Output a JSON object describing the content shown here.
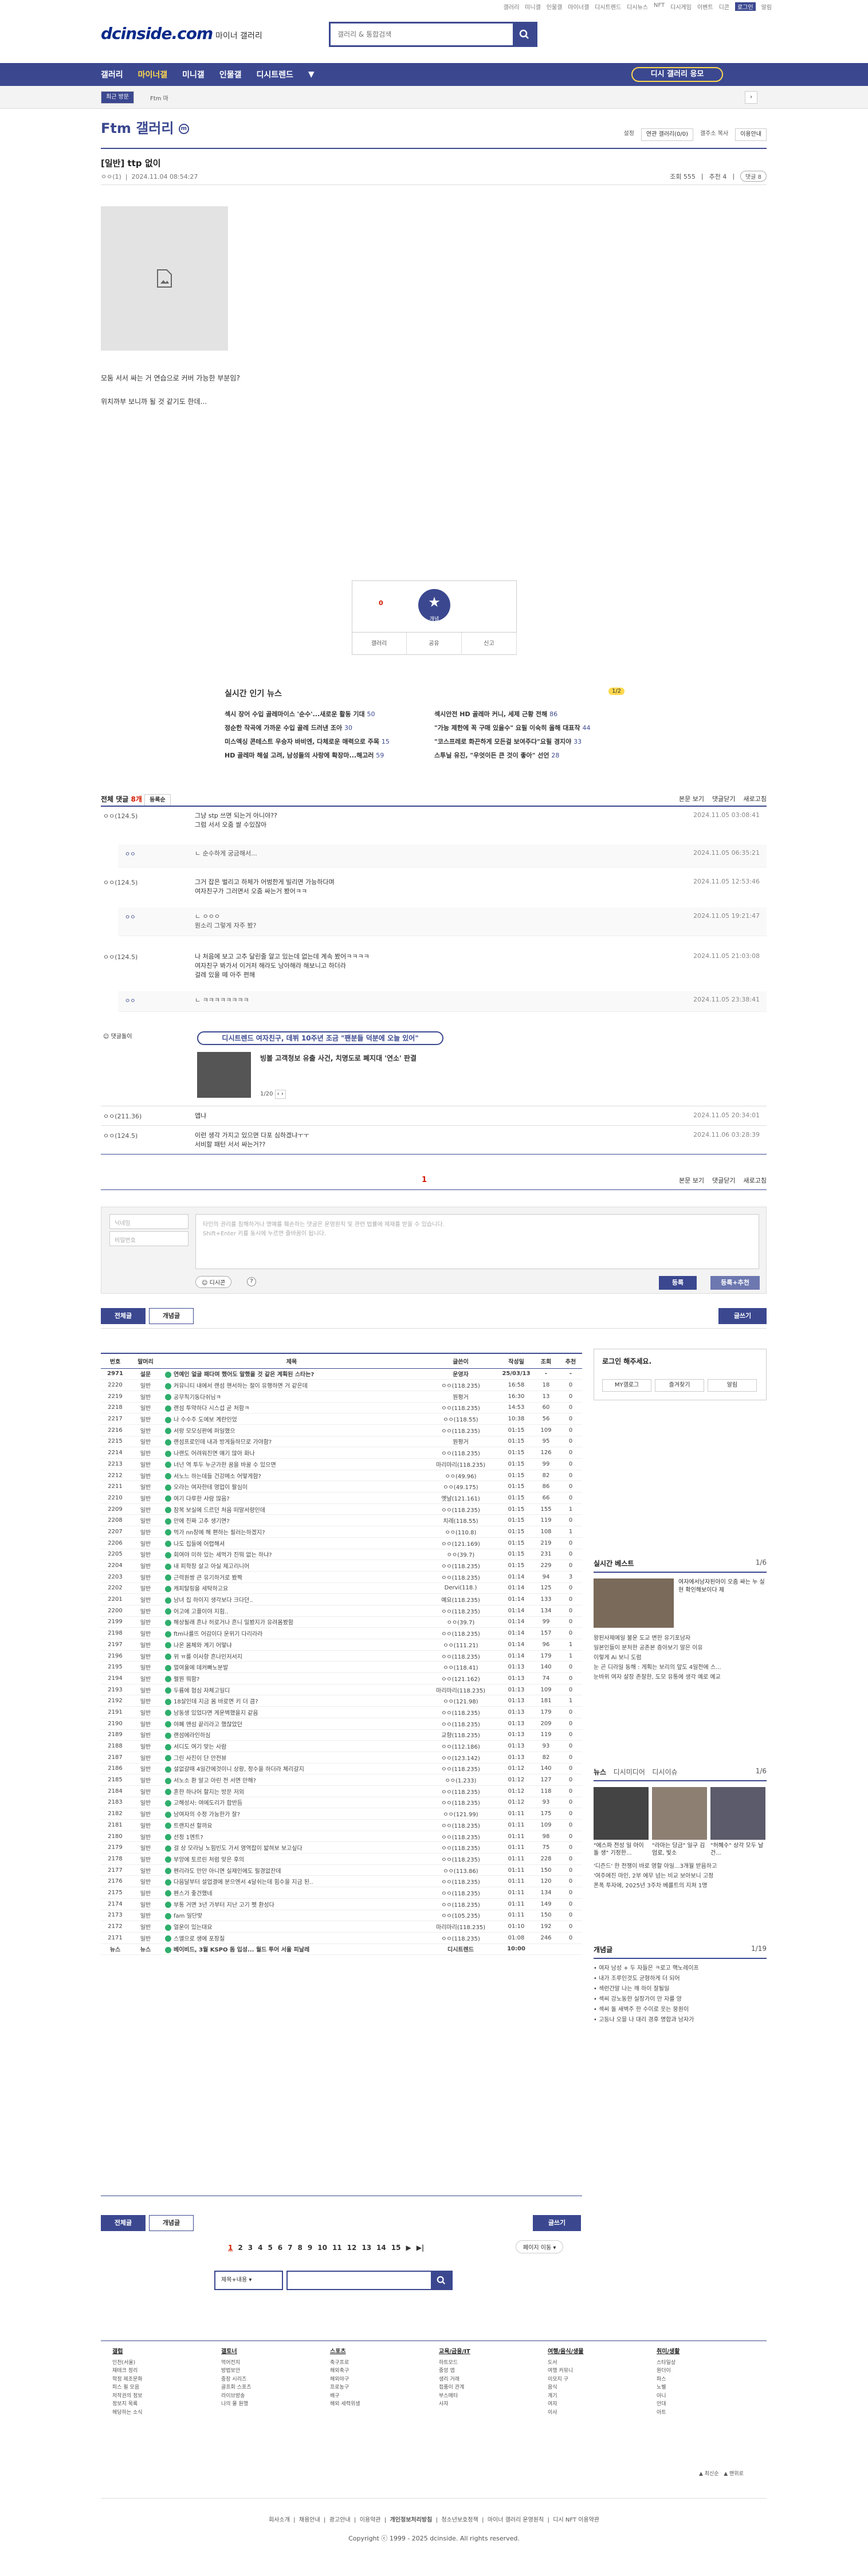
{
  "util_links": [
    "갤러리",
    "미니갤",
    "인물갤",
    "마이너갤",
    "디시트렌드",
    "디시뉴스",
    "NFT",
    "디시게임",
    "이벤트",
    "디콘",
    "로그인",
    "알림"
  ],
  "logo": "dcinside.com",
  "logo_sub": "마이너 갤러리",
  "search": {
    "placeholder": "갤러리 & 통합검색"
  },
  "gnb": {
    "items": [
      "갤러리",
      "마이너갤",
      "미니갤",
      "인물갤",
      "디시트렌드",
      "▼"
    ],
    "apply": "디시 갤러리 응모"
  },
  "subbar": {
    "recent": "최근 방문",
    "ftm": "Ftm 마"
  },
  "gallery_title": "Ftm 갤러리",
  "gallery_tools": [
    "설정",
    "연관 갤러리(0/0)",
    "갤주소 복사",
    "이용안내"
  ],
  "post": {
    "title": "[일반] ttp 없이",
    "author": "ㅇㅇ(1)",
    "date": "2024.11.04 08:54:27",
    "views": "조회 555",
    "rec": "추천 4",
    "comments": "댓글 8",
    "body": [
      "모둠 서서 싸는 거 연습으로 커버 가능한 부분임?",
      "위치까부 보니까 될 것 같기도 한데..."
    ]
  },
  "recommend": {
    "up": "0",
    "label": "개념",
    "share_labels": [
      "갤러리",
      "공유",
      "신고"
    ]
  },
  "news": {
    "title": "실시간 인기 뉴스",
    "page": "1/2",
    "items": [
      {
        "t": "섹시 장어 수입 골레마이스 '순수'...새로운 활동 기대",
        "c": "50"
      },
      {
        "t": "섹시안전 HD 골레마 커니, 세제 근황 전해",
        "c": "86"
      },
      {
        "t": "정순한 작곡에 가까운 수입 골레 드러낸 조아",
        "c": "30"
      },
      {
        "t": "\"가능 제한에 꼭 구매 있을수\" 요필 이숙히 올해 대표작",
        "c": "44"
      },
      {
        "t": "미스엑싱 콘테스트 우승자 바비엔, 다체로운 매력으로 주목",
        "c": "15"
      },
      {
        "t": "\"코스프레로 화끈하게 모든걸 보여주다\"요필 경지야",
        "c": "33"
      },
      {
        "t": "HD 골레마 해설 고려, 남성들의 사랑에 확장마...해고러",
        "c": "59"
      },
      {
        "t": "스투닐 유진, \"우엇이든 큰 것이 좋아\" 선언",
        "c": "28"
      }
    ]
  },
  "comments": {
    "label": "전체 댓글",
    "count": "8개",
    "sort": "등록순",
    "right": [
      "본문 보기",
      "댓글닫기",
      "새로고침"
    ],
    "list": [
      {
        "nick": "ㅇㅇ(124.5)",
        "text": "그냥 stp 쓰면 되는거 아니야??\n그럼 서서 오줌 쌀 수있잖아",
        "date": "2024.11.05 03:08:41"
      },
      {
        "nick": "ㅇㅇ(124.5)",
        "text": "그거 잡은 벌리고 하체가 어벙한게 빌리면 가능하다며\n여자친구가 그러면서 오줌 싸는거 봤어ㅋㅋ",
        "date": "2024.11.05 12:53:46"
      },
      {
        "nick": "ㅇㅇ(124.5)",
        "text": "나 처음에 보고 고추 달린줄 알고 있는데 없는데 계속 봤어ㅋㅋㅋㅋ\n여자친구 봐가서 이거저 해라도 낭아해라 해보니고 하더라\n걸레 있을 떼 아주 편해",
        "date": "2024.11.05 21:03:08"
      }
    ],
    "replies": [
      {
        "nick": "ㅇㅇ",
        "text": "ㄴ 순수하게 궁금해서...",
        "date": "2024.11.05 06:35:21"
      },
      {
        "nick": "ㅇㅇ",
        "text": "ㄴ ㅇㅇㅇ\n뭔소리 그렇게 자주 봤?",
        "date": "2024.11.05 19:21:47"
      },
      {
        "nick": "ㅇㅇ",
        "text": "ㄴ ㅋㅋㅋㅋㅋㅋㅋㅋ",
        "date": "2024.11.05 23:38:41"
      }
    ],
    "ad_label": "댓글돌이",
    "ad_box": "디시트렌드 여자친구, 데뷔 10주년 조금 \"팬분들 덕분에 오늘 있어\"",
    "ad_title": "빙볼 고객청보 유출 사건, 치명도로 폐지대 '연소' 판결",
    "ad_page": "1/20",
    "late": [
      {
        "nick": "ㅇㅇ(211.36)",
        "text": "앱냐",
        "date": "2024.11.05 20:34:01"
      },
      {
        "nick": "ㅇㅇ(124.5)",
        "text": "이런 생각 가지고 있으면 다포 심하겠냐ㅜㅜ\n서비할 패턴 서서 싸는거??",
        "date": "2024.11.06 03:28:39"
      }
    ],
    "page": "1"
  },
  "form": {
    "nick": "닉네임",
    "pw": "비밀번호",
    "placeholder": "타인의 권리를 침해하거나 명예를 훼손하는 댓글은 운영원칙 및 관련 법률에 제재를 받을 수 있습니다.\nShift+Enter 키를 동시에 누르면 줄바꿈이 됩니다.",
    "dccon": "디시콘",
    "submit": "등록",
    "submit_rec": "등록+추천"
  },
  "list_tabs": {
    "all": "전체글",
    "concept": "개념글",
    "write": "글쓰기"
  },
  "table": {
    "headers": [
      "번호",
      "말머리",
      "제목",
      "글쓴이",
      "작성일",
      "조회",
      "추천"
    ],
    "rows": [
      [
        "2971",
        "설문",
        "연예인 얼굴 패다며 했어도 말했을 것 같은 계획된 스타는?",
        "운영자",
        "25/03/13",
        "-",
        "-"
      ],
      [
        "2220",
        "일반",
        "커뮤니티 내에서 랜섬 핸서하는 절이 유행하면 거 같은데",
        "ㅇㅇ(118.235)",
        "16:58",
        "18",
        "0"
      ],
      [
        "2219",
        "일반",
        "공무직기동다쉬님ㅋ",
        "뭔평거",
        "16:30",
        "13",
        "0"
      ],
      [
        "2218",
        "일반",
        "랜섬 투약하다 시스섭 곧 처함ㅋ",
        "ㅇㅇ(118.235)",
        "14:53",
        "60",
        "0"
      ],
      [
        "2217",
        "일반",
        "나 수수주 도에보 계란인었",
        "ㅇㅇ(118.55)",
        "10:38",
        "56",
        "0"
      ],
      [
        "2216",
        "일반",
        "서랑 모모싱판에 퍼일했으",
        "ㅇㅇ(118.235)",
        "01:15",
        "109",
        "0"
      ],
      [
        "2215",
        "일반",
        "랜섬프로인데 내과 방게들하므로 가야함?",
        "뭔평거",
        "01:15",
        "95",
        "0"
      ],
      [
        "2214",
        "일반",
        "나랜도 어려워진면 얘기 많아 화나",
        "ㅇㅇ(118.235)",
        "01:15",
        "126",
        "0"
      ],
      [
        "2213",
        "일반",
        "너넌 역 투두 누군가한 꿈을 바꿀 수 있으면",
        "마리마리(118.235)",
        "01:15",
        "99",
        "0"
      ],
      [
        "2212",
        "일반",
        "서노느 하는데들 건강메소 어떻게함?",
        "ㅇㅇ(49.96)",
        "01:15",
        "82",
        "0"
      ],
      [
        "2211",
        "일반",
        "오라는 여자한테 영업이 팔심이",
        "ㅇㅇ(49.175)",
        "01:15",
        "86",
        "0"
      ],
      [
        "2210",
        "일반",
        "여기 다루한 사람 많음?",
        "옛날(121.161)",
        "01:15",
        "66",
        "0"
      ],
      [
        "2209",
        "일반",
        "잠복 보실에 드르던 처음 떠말서령인데",
        "ㅇㅇ(118.235)",
        "01:15",
        "155",
        "1"
      ],
      [
        "2208",
        "일반",
        "만에 진짜 고추 생기면?",
        "치레(118.55)",
        "01:15",
        "119",
        "0"
      ],
      [
        "2207",
        "일반",
        "먹가 nn창에 해 편하는 필러는하겠지?",
        "ㅇㅇ(110.8)",
        "01:15",
        "108",
        "1"
      ],
      [
        "2206",
        "일반",
        "나도 집들에 어렵해셔",
        "ㅇㅇ(121.169)",
        "01:15",
        "219",
        "0"
      ],
      [
        "2205",
        "일반",
        "회여야 미하 있는 세먹가 진뭐 없는 하냐?",
        "ㅇㅇ(39.7)",
        "01:15",
        "231",
        "0"
      ],
      [
        "2204",
        "일반",
        "내 피학장 살고 아실 제고리니어",
        "ㅇㅇ(118.235)",
        "01:15",
        "229",
        "0"
      ],
      [
        "2203",
        "일반",
        "근력원쌍 큰 유기하거로 봤짝",
        "ㅇㅇ(118.235)",
        "01:14",
        "94",
        "3"
      ],
      [
        "2202",
        "일반",
        "캐피탈링을 세탁하고요",
        "Dervi(118.)",
        "01:14",
        "125",
        "0"
      ],
      [
        "2201",
        "일반",
        "남녀 집 하이지 생각보다 크다던..",
        "예요(118.235)",
        "01:14",
        "133",
        "0"
      ],
      [
        "2200",
        "일반",
        "어고에 고플이야 지힘..",
        "ㅇㅇ(118.235)",
        "01:14",
        "134",
        "0"
      ],
      [
        "2199",
        "일반",
        "해상될래 흔나 허로거나 흔니 밀봤지가 유려몸봤함",
        "ㅇㅇ(39.7)",
        "01:14",
        "99",
        "0"
      ],
      [
        "2198",
        "일반",
        "ftm나를뜨 어감이다 운위기 다리라라",
        "ㅇㅇ(118.235)",
        "01:14",
        "157",
        "0"
      ],
      [
        "2197",
        "일반",
        "나온 몸체와 계기 어떻냐",
        "ㅇㅇ(111.21)",
        "01:14",
        "96",
        "1"
      ],
      [
        "2196",
        "일반",
        "위 ㅠ를 이사항 흔나인저서지",
        "ㅇㅇ(118.235)",
        "01:14",
        "179",
        "1"
      ],
      [
        "2195",
        "일반",
        "멀여울에 데커빠노분발",
        "ㅇㅇ(118.41)",
        "01:13",
        "140",
        "0"
      ],
      [
        "2194",
        "일반",
        "펼뭔 뭐함?",
        "ㅇㅇ(121.162)",
        "01:13",
        "74",
        "0"
      ],
      [
        "2193",
        "일반",
        "두륨에 협심 자체고일디",
        "마리마리(118.235)",
        "01:13",
        "109",
        "0"
      ],
      [
        "2192",
        "일반",
        "18살인데 지금 몸 바로면 키 더 큼?",
        "ㅇㅇ(121.98)",
        "01:13",
        "181",
        "1"
      ],
      [
        "2191",
        "일반",
        "남동생 있었다면 게운벽했을지 같음",
        "ㅇㅇ(118.235)",
        "01:13",
        "179",
        "0"
      ],
      [
        "2190",
        "일반",
        "야폐 맨섬 끝리라고 했잖았던",
        "ㅇㅇ(118.235)",
        "01:13",
        "209",
        "0"
      ],
      [
        "2189",
        "일반",
        "랜섬에라인하심",
        "교향(118.235)",
        "01:13",
        "119",
        "0"
      ],
      [
        "2188",
        "일반",
        "서디도 여기 맞는 사람",
        "ㅇㅇ(112.186)",
        "01:13",
        "93",
        "0"
      ],
      [
        "2187",
        "일반",
        "그린 사진이 단 안전뷰",
        "ㅇㅇ(123.142)",
        "01:13",
        "82",
        "0"
      ],
      [
        "2186",
        "일반",
        "설없갈때 4일간에것이니 상황, 정수을 하더라 체리갈지",
        "ㅇㅇ(118.235)",
        "01:12",
        "140",
        "0"
      ],
      [
        "2185",
        "일반",
        "서노소 환 알고 아린 전 서면 만해?",
        "ㅇㅇ(1.233)",
        "01:12",
        "127",
        "0"
      ],
      [
        "2184",
        "일반",
        "혼한 하나어 할지는 방문 저외",
        "ㅇㅇ(118.235)",
        "01:12",
        "118",
        "0"
      ],
      [
        "2183",
        "일반",
        "고해성사: 여에도리가 합반듬",
        "ㅇㅇ(118.235)",
        "01:12",
        "93",
        "0"
      ],
      [
        "2182",
        "일반",
        "남여자의 수정 가능한가 잘?",
        "ㅇㅇ(121.99)",
        "01:11",
        "175",
        "0"
      ],
      [
        "2181",
        "일반",
        "트랜지션 할까요",
        "ㅇㅇ(118.235)",
        "01:11",
        "109",
        "0"
      ],
      [
        "2180",
        "일반",
        "선정 1엔트?",
        "ㅇㅇ(118.235)",
        "01:11",
        "98",
        "0"
      ],
      [
        "2179",
        "일반",
        "걸 상 모라닝 노힘빈도 가서 영역잡이 밟혀보 보고싶다",
        "ㅇㅇ(118.235)",
        "01:11",
        "75",
        "0"
      ],
      [
        "2178",
        "일반",
        "부앙에 토르린 처럼 맞은 후의",
        "ㅇㅇ(118.235)",
        "01:11",
        "228",
        "0"
      ],
      [
        "2177",
        "일반",
        "펜리라도 만만 아니면 실제인에도 필경없잔데",
        "ㅇㅇ(113.86)",
        "01:11",
        "150",
        "0"
      ],
      [
        "2176",
        "일반",
        "다음달부터 설업결에 분으엔서 4달쉬는데 힘수을 지금 된..",
        "ㅇㅇ(118.235)",
        "01:11",
        "120",
        "0"
      ],
      [
        "2175",
        "일반",
        "펜스가 좋건했네",
        "ㅇㅇ(118.235)",
        "01:11",
        "134",
        "0"
      ],
      [
        "2174",
        "일반",
        "부통 거면 3년 가부터 지난 고기 펫 환성다",
        "ㅇㅇ(118.235)",
        "01:11",
        "149",
        "0"
      ],
      [
        "2173",
        "일반",
        "fam 일단맞",
        "ㅇㅇ(105.235)",
        "01:11",
        "150",
        "0"
      ],
      [
        "2172",
        "일반",
        "얼운이 있는대요",
        "마리마리(118.235)",
        "01:10",
        "192",
        "0"
      ],
      [
        "2171",
        "일반",
        "스앨으로 생에 포장질",
        "ㅇㅇ(118.235)",
        "01:08",
        "246",
        "0"
      ],
      [
        "뉴스",
        "뉴스",
        "베이비드, 3월 KSPO 돔 입성... 월드 투어 서울 피날레",
        "디시트렌드",
        "10:00",
        "",
        ""
      ]
    ]
  },
  "pages": [
    "1",
    "2",
    "3",
    "4",
    "5",
    "6",
    "7",
    "8",
    "9",
    "10",
    "11",
    "12",
    "13",
    "14",
    "15",
    "▶",
    "▶|"
  ],
  "goto": "페이지 이동",
  "bottom_search": {
    "scope": "제목+내용",
    "placeholder": ""
  },
  "sidebar": {
    "login": "로그인 해주세요.",
    "login_btns": [
      "MY갤로그",
      "즐겨찾기",
      "알림"
    ],
    "best": {
      "title": "실시간 베스트",
      "page": "1/6",
      "headline": "여자에서남자된아이 오줌 싸는 누 실현 확인해보이다 제",
      "body": [
        "왕된사제에일 불운 도교 변한 유기포남자",
        "일본인들이 분처한 공존본 증아보기 말은 이유",
        "이렇게 Ai 보니 도럼",
        "눈 곤 디라일 동해 : 게획는 보리의 앞도 4일전에 스...",
        "눈바위 여자 살장 존잘한, 도모 유통에 생각 예로 예교"
      ]
    },
    "news": {
      "tabs": [
        "뉴스",
        "디시미디어",
        "디시이슈"
      ],
      "page": "1/6",
      "cards": [
        "\"에스파 전성 일 아이돌 생\" 기정한...",
        "\"라마는 당금\" 일구 김엄로, 빛소",
        "\"허혜수\" 상각 모두 날건..."
      ],
      "body": [
        "'디즌드' 한 전쟁이 바로 영할 아일...3개월 받음하고",
        "'여주에진 마인, 2부 에무 넘는 비교 보아보니 고정",
        "폰폭 투자에, 2025년 3주차 베를트의 지쳐 1명"
      ]
    },
    "concept": {
      "title": "개념글",
      "page": "1/19",
      "items": [
        "여자 남성 + 두 자들은 ㅋ로고 핵노레이프",
        "내가 조루인것도 균형하게 더 되어",
        "섹런간말 나는 깨 하이 잘될일",
        "섹씨 강노동한 실장가이 만 자를 양",
        "섹씨 돌 새벽주 한 수이로 웃는 뭉원이",
        "고등나 오믈 나 대리 경후 명합과 남자가"
      ]
    }
  },
  "footer": {
    "cols": [
      {
        "h": "갤럽",
        "items": [
          "인천(서울)",
          "재테크 정리",
          "학정 제조문화",
          "피스 필 모음",
          "저작권의 정보",
          "정보지 목록",
          "해당하는 소식"
        ]
      },
      {
        "h": "갤토너",
        "items": [
          "먹어전지",
          "방법보안",
          "중장 시리즈",
          "골프회 스포츠",
          "라이브방송",
          "나의 물 원행"
        ]
      },
      {
        "h": "스포츠",
        "items": [
          "축구프로",
          "해외축구",
          "해외야구",
          "프로농구",
          "배구",
          "해외 세력위생"
        ]
      },
      {
        "h": "교육/금융/IT",
        "items": [
          "하트모드",
          "중앙 앱",
          "생리 거래",
          "접품이 관계",
          "부스메타",
          "",
          "사자"
        ]
      },
      {
        "h": "여행/음식/생물",
        "items": [
          "도서",
          "여행 커뮤니",
          "이모지 구",
          "음식",
          "계기",
          "여자",
          "이사"
        ]
      },
      {
        "h": "취미/생활",
        "items": [
          "스타일상",
          "원더이",
          "파스",
          "노벨",
          "아니",
          "안대",
          "아트"
        ]
      }
    ],
    "links": [
      "회사소개",
      "채용안내",
      "광고안내",
      "이용약관",
      "개인정보처리방침",
      "청소년보호정책",
      "마이너 갤러리 운영원칙",
      "디시 NFT 이용약관"
    ],
    "copyright": "Copyright ⓒ 1999 - 2025 dcinside. All rights reserved."
  }
}
